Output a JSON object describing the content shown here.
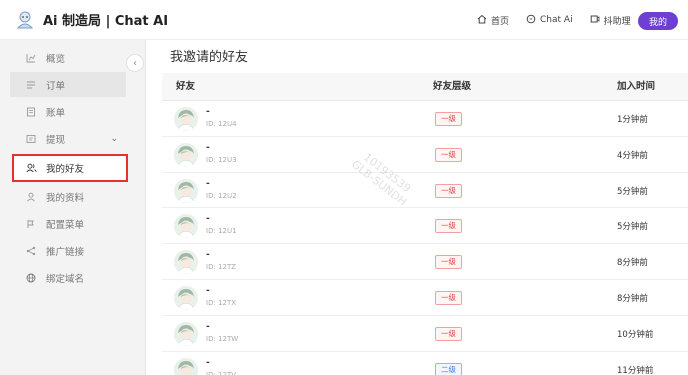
{
  "header": {
    "brand": "Ai 制造局 | Chat AI",
    "nav": [
      {
        "label": "首页",
        "icon": "home-icon"
      },
      {
        "label": "Chat Ai",
        "icon": "chat-icon"
      },
      {
        "label": "抖助理",
        "icon": "assistant-icon"
      }
    ],
    "my_button": "我的"
  },
  "sidebar": {
    "items": [
      {
        "label": "概览",
        "icon": "chart-icon"
      },
      {
        "label": "订单",
        "icon": "order-icon"
      },
      {
        "label": "账单",
        "icon": "bill-icon"
      },
      {
        "label": "提现",
        "icon": "withdraw-icon"
      },
      {
        "label": "我的好友",
        "icon": "friends-icon"
      },
      {
        "label": "我的资料",
        "icon": "profile-icon"
      },
      {
        "label": "配置菜单",
        "icon": "config-icon"
      },
      {
        "label": "推广链接",
        "icon": "share-icon"
      },
      {
        "label": "绑定域名",
        "icon": "globe-icon"
      }
    ],
    "collapse_icon": "chevron-left-icon"
  },
  "main": {
    "title": "我邀请的好友",
    "columns": [
      "好友",
      "好友层级",
      "加入时间"
    ],
    "rows": [
      {
        "name": "-",
        "id": "ID: 12U4",
        "level": "一级",
        "level_color": "red",
        "time": "1分钟前"
      },
      {
        "name": "-",
        "id": "ID: 12U3",
        "level": "一级",
        "level_color": "red",
        "time": "4分钟前"
      },
      {
        "name": "-",
        "id": "ID: 12U2",
        "level": "一级",
        "level_color": "red",
        "time": "5分钟前"
      },
      {
        "name": "-",
        "id": "ID: 12U1",
        "level": "一级",
        "level_color": "red",
        "time": "5分钟前"
      },
      {
        "name": "-",
        "id": "ID: 12TZ",
        "level": "一级",
        "level_color": "red",
        "time": "8分钟前"
      },
      {
        "name": "-",
        "id": "ID: 12TX",
        "level": "一级",
        "level_color": "red",
        "time": "8分钟前"
      },
      {
        "name": "-",
        "id": "ID: 12TW",
        "level": "一级",
        "level_color": "red",
        "time": "10分钟前"
      },
      {
        "name": "-",
        "id": "ID: 12TV",
        "level": "二级",
        "level_color": "blue",
        "time": "11分钟前"
      }
    ]
  },
  "watermark": {
    "line1": "10193539",
    "line2": "GLB-SUNDH"
  },
  "colors": {
    "accent": "#6d3fd2",
    "highlight": "#e2322b",
    "level1": "#e04444",
    "level2": "#3a7de0"
  }
}
